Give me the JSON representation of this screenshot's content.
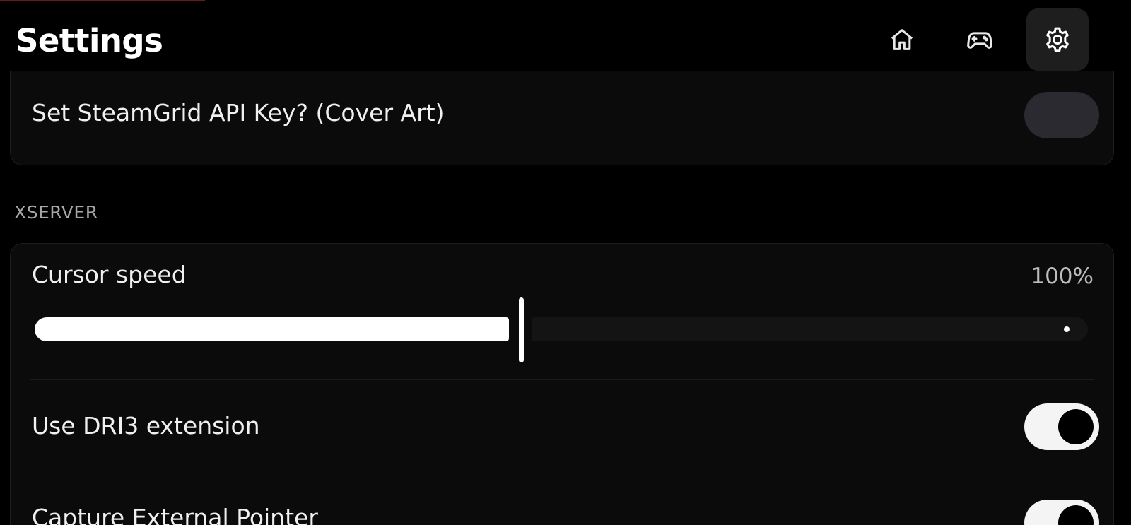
{
  "header": {
    "title": "Settings",
    "nav": [
      {
        "name": "home",
        "icon": "home-icon",
        "active": false
      },
      {
        "name": "games",
        "icon": "gamepad-icon",
        "active": false
      },
      {
        "name": "settings",
        "icon": "gear-icon",
        "active": true
      }
    ]
  },
  "steamgrid": {
    "label": "Set SteamGrid API Key? (Cover Art)",
    "enabled": false
  },
  "xserver": {
    "section_title": "XSERVER",
    "cursor_speed": {
      "label": "Cursor speed",
      "value_text": "100%",
      "fraction": 0.46
    },
    "dri3": {
      "label": "Use DRI3 extension",
      "enabled": true
    },
    "capture_pointer": {
      "label": "Capture External Pointer",
      "enabled": true
    }
  },
  "colors": {
    "background": "#000000",
    "card": "#0b0b0b",
    "toggle_off": "#2a2a30",
    "toggle_on": "#f4f4f4",
    "muted_text": "#a7a7a7"
  }
}
